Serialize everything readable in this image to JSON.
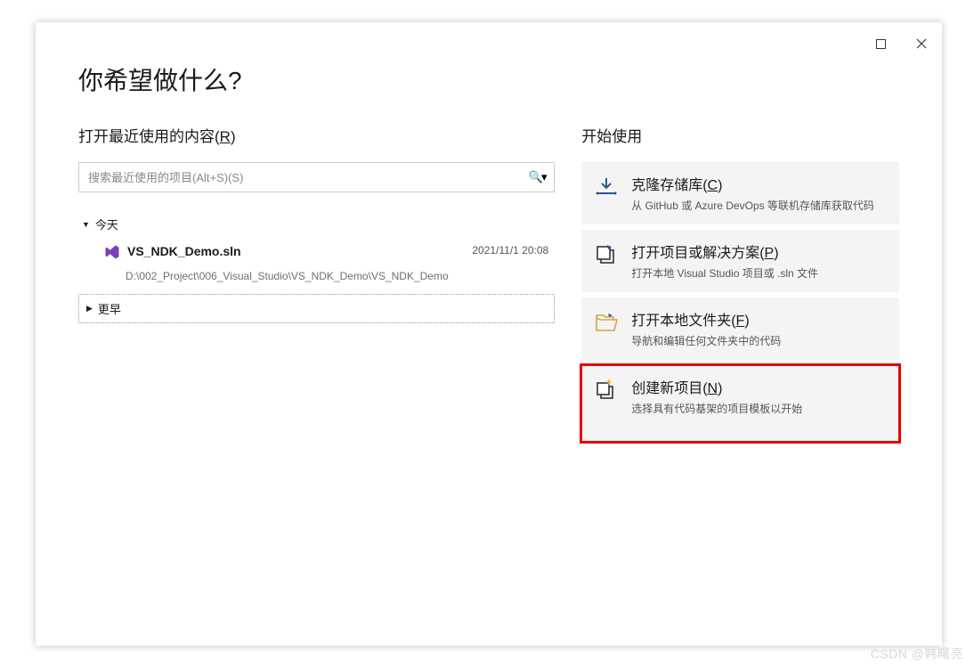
{
  "page_title": "你希望做什么?",
  "recent": {
    "section_title_pre": "打开最近使用的内容(",
    "section_title_hotkey": "R",
    "section_title_post": ")",
    "search_placeholder": "搜索最近使用的项目(Alt+S)(S)",
    "group_today": "今天",
    "group_earlier": "更早",
    "items": [
      {
        "name": "VS_NDK_Demo.sln",
        "date": "2021/11/1 20:08",
        "path": "D:\\002_Project\\006_Visual_Studio\\VS_NDK_Demo\\VS_NDK_Demo"
      }
    ]
  },
  "start": {
    "section_title": "开始使用",
    "actions": [
      {
        "title_pre": "克隆存储库(",
        "hotkey": "C",
        "title_post": ")",
        "desc": "从 GitHub 或 Azure DevOps 等联机存储库获取代码"
      },
      {
        "title_pre": "打开项目或解决方案(",
        "hotkey": "P",
        "title_post": ")",
        "desc": "打开本地 Visual Studio 项目或 .sln 文件"
      },
      {
        "title_pre": "打开本地文件夹(",
        "hotkey": "F",
        "title_post": ")",
        "desc": "导航和编辑任何文件夹中的代码"
      },
      {
        "title_pre": "创建新项目(",
        "hotkey": "N",
        "title_post": ")",
        "desc": "选择具有代码基架的项目模板以开始"
      }
    ]
  },
  "watermark": "CSDN @韩曙亮"
}
